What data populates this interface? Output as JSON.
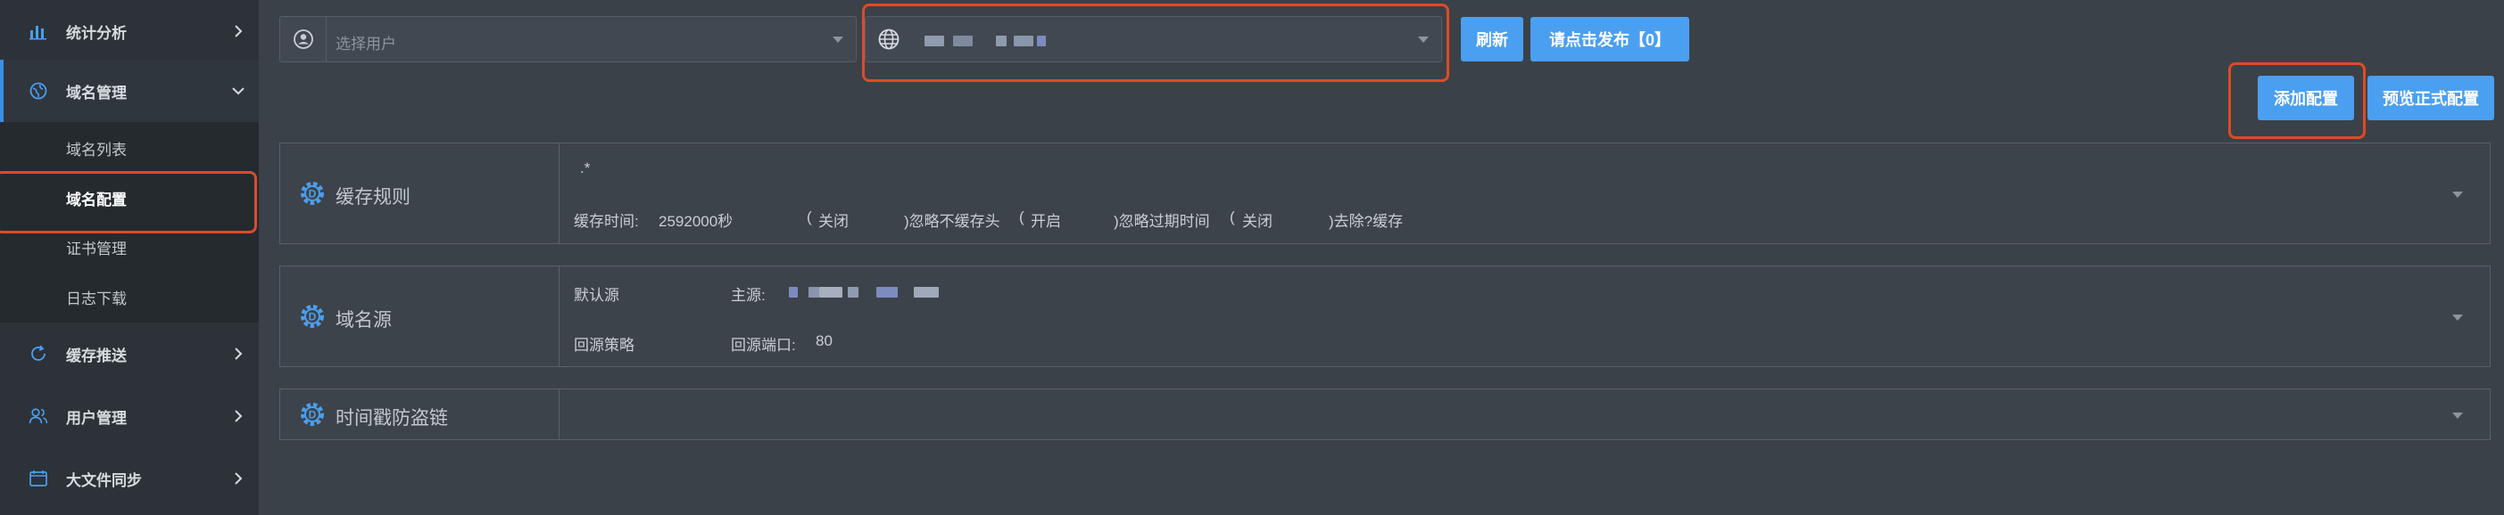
{
  "sidebar": {
    "items": [
      {
        "label": "统计分析",
        "icon": "bar-chart-icon"
      },
      {
        "label": "域名管理",
        "icon": "globe-icon"
      },
      {
        "label": "缓存推送",
        "icon": "refresh-icon"
      },
      {
        "label": "用户管理",
        "icon": "users-icon"
      },
      {
        "label": "大文件同步",
        "icon": "folder-icon"
      }
    ],
    "submenu": [
      "域名列表",
      "域名配置",
      "证书管理",
      "日志下载"
    ]
  },
  "toolbar": {
    "user_select_placeholder": "选择用户",
    "refresh_label": "刷新",
    "publish_label": "请点击发布【0】",
    "add_config_label": "添加配置",
    "preview_label": "预览正式配置"
  },
  "panels": {
    "cache": {
      "title": "缓存规则",
      "pattern": ".*",
      "time_label": "缓存时间:",
      "time_value": "2592000秒",
      "paren1": "(",
      "opt1_value": "关闭",
      "opt1_label": ")忽略不缓存头",
      "paren2": "(",
      "opt2_value": "开启",
      "opt2_label": ")忽略过期时间",
      "paren3": "(",
      "opt3_value": "关闭",
      "opt3_label": ")去除?缓存"
    },
    "origin": {
      "title": "域名源",
      "default_label": "默认源",
      "primary_label": "主源:",
      "strategy_label": "回源策略",
      "port_label": "回源端口:",
      "port_value": "80"
    },
    "antileech": {
      "title": "时间戳防盗链"
    }
  },
  "colors": {
    "accent": "#4a9ff0",
    "highlight": "#e04a24",
    "sidebar_bg": "#2c3238",
    "main_bg": "#3b4148"
  }
}
